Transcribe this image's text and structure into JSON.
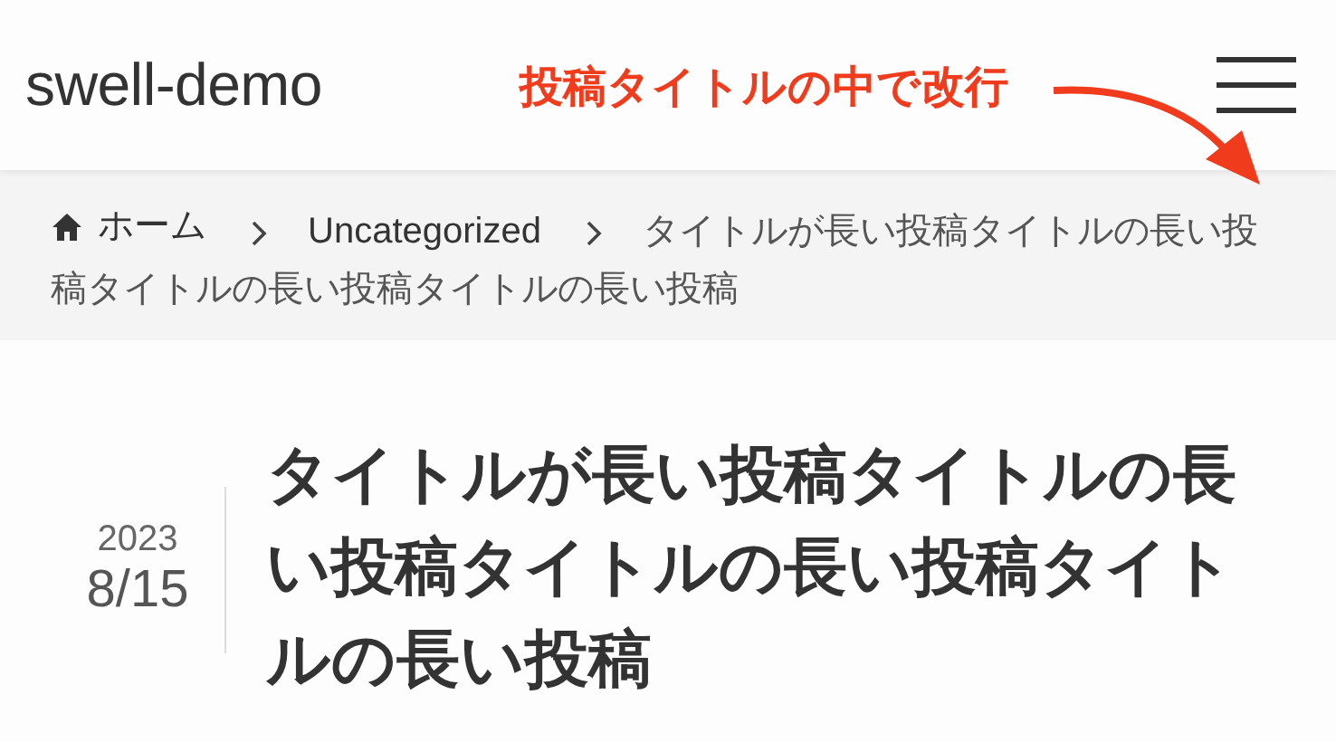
{
  "header": {
    "site_title": "swell-demo"
  },
  "annotation": {
    "text": "投稿タイトルの中で改行"
  },
  "breadcrumb": [
    {
      "kind": "home",
      "label": "ホーム"
    },
    {
      "kind": "link",
      "label": "Uncategorized"
    },
    {
      "kind": "current",
      "label": "タイトルが長い投稿タイトルの長い投稿タイトルの長い投稿タイトルの長い投稿"
    }
  ],
  "post": {
    "year": "2023",
    "date": "8/15",
    "title": "タイトルが長い投稿タイトルの長い投稿タイトルの長い投稿タイトルの長い投稿"
  }
}
